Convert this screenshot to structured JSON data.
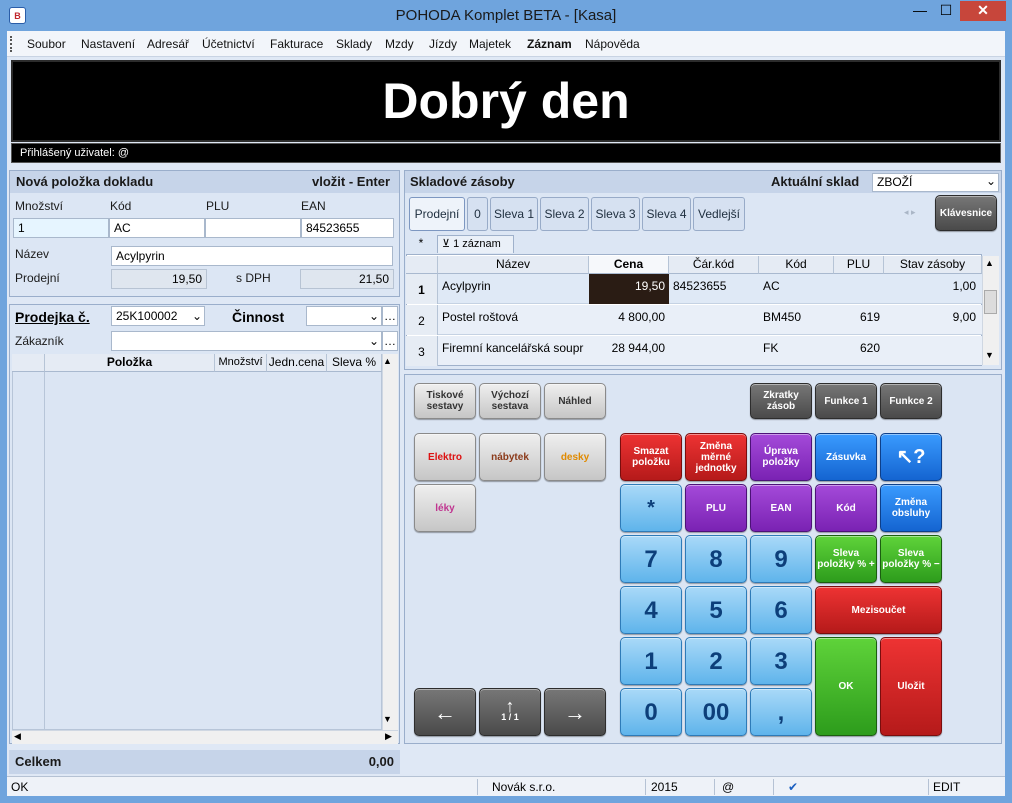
{
  "window": {
    "title": "POHODA Komplet BETA - [Kasa]",
    "icon_text": "B"
  },
  "menu": [
    "Soubor",
    "Nastavení",
    "Adresář",
    "Účetnictví",
    "Fakturace",
    "Sklady",
    "Mzdy",
    "Jízdy",
    "Majetek",
    "Záznam",
    "Nápověda"
  ],
  "banner": {
    "greeting": "Dobrý den",
    "user_label": "Přihlášený uživatel: @"
  },
  "new_item": {
    "title": "Nová položka dokladu",
    "insert_hint": "vložit - Enter",
    "qty_label": "Množství",
    "code_label": "Kód",
    "plu_label": "PLU",
    "ean_label": "EAN",
    "qty_value": "1",
    "code_value": "AC",
    "plu_value": "",
    "ean_value": "84523655",
    "name_label": "Název",
    "name_value": "Acylpyrin",
    "price_label": "Prodejní",
    "price_value": "19,50",
    "vat_label": "s DPH",
    "vat_value": "21,50"
  },
  "receipt": {
    "number_label": "Prodejka č.",
    "number_value": "25K100002",
    "activity_label": "Činnost",
    "activity_value": "",
    "customer_label": "Zákazník",
    "customer_value": "",
    "columns": [
      "Položka",
      "Množství",
      "Jedn.cena",
      "Sleva %"
    ],
    "total_label": "Celkem",
    "total_value": "0,00"
  },
  "stock": {
    "title": "Skladové zásoby",
    "warehouse_label": "Aktuální sklad",
    "warehouse_value": "ZBOŽÍ",
    "tabs": [
      "Prodejní",
      "0",
      "Sleva 1",
      "Sleva 2",
      "Sleva 3",
      "Sleva 4",
      "Vedlejší"
    ],
    "keyboard_button": "Klávesnice",
    "filter_star": "*",
    "filter_label": "1 záznam",
    "columns": [
      "Název",
      "Cena",
      "Čár.kód",
      "Kód",
      "PLU",
      "Stav zásoby"
    ],
    "rows": [
      {
        "idx": "1",
        "name": "Acylpyrin",
        "price": "19,50",
        "barcode": "84523655",
        "code": "AC",
        "plu": "",
        "stock": "1,00"
      },
      {
        "idx": "2",
        "name": "Postel roštová",
        "price": "4 800,00",
        "barcode": "",
        "code": "BM450",
        "plu": "619",
        "stock": "9,00"
      },
      {
        "idx": "3",
        "name": "Firemní kancelářská soupr",
        "price": "28 944,00",
        "barcode": "",
        "code": "FK",
        "plu": "620",
        "stock": ""
      }
    ]
  },
  "keypad": {
    "print_sets": "Tiskové sestavy",
    "default_set": "Výchozí sestava",
    "preview": "Náhled",
    "stock_shortcuts": "Zkratky zásob",
    "func1": "Funkce 1",
    "func2": "Funkce 2",
    "categories": [
      "Elektro",
      "nábytek",
      "desky",
      "léky"
    ],
    "delete_item": "Smazat položku",
    "change_unit": "Změna měrné jednotky",
    "edit_item": "Úprava položky",
    "drawer": "Zásuvka",
    "help": "↖?",
    "star": "*",
    "plu": "PLU",
    "ean": "EAN",
    "code": "Kód",
    "change_operator": "Změna obsluhy",
    "discount_plus": "Sleva položky % +",
    "discount_minus": "Sleva položky % −",
    "subtotal": "Mezisoučet",
    "ok": "OK",
    "save": "Uložit",
    "digits": [
      "7",
      "8",
      "9",
      "4",
      "5",
      "6",
      "1",
      "2",
      "3",
      "0",
      "00",
      ","
    ],
    "page": "1 / 1"
  },
  "status": {
    "left": "OK",
    "company": "Novák s.r.o.",
    "year": "2015",
    "at": "@",
    "mode": "EDIT"
  }
}
